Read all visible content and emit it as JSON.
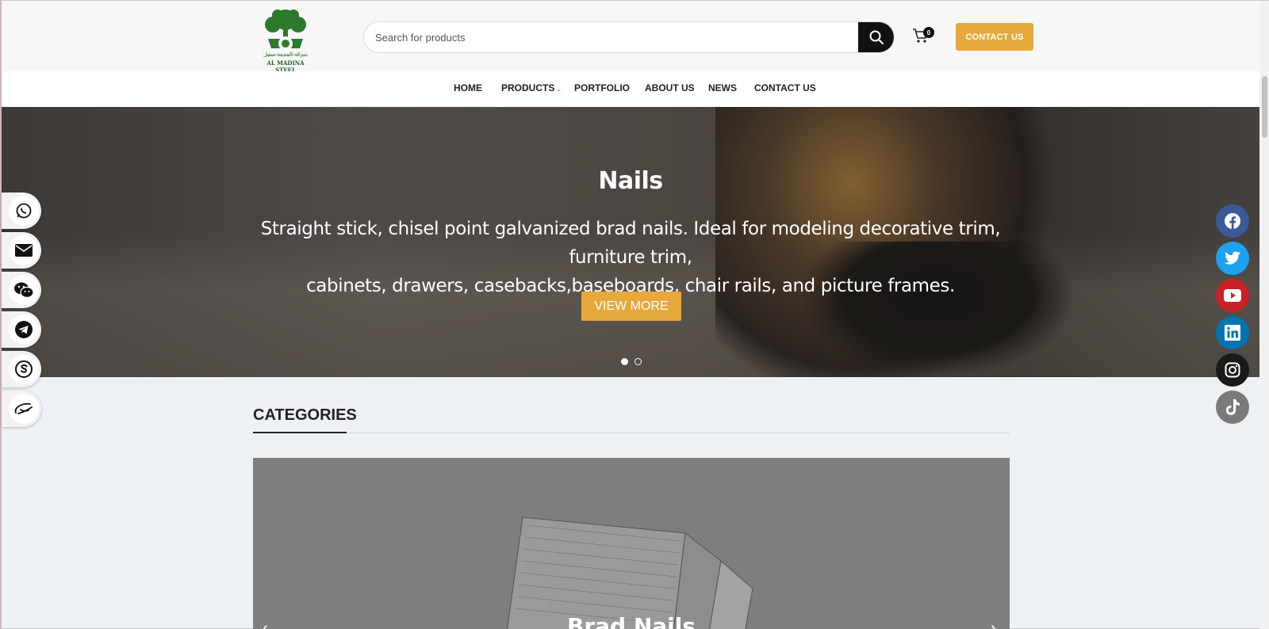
{
  "brand": {
    "logo_arabic": "شركة المدينة ستيل",
    "logo_english": "AL MADINA STEEL"
  },
  "header": {
    "search_placeholder": "Search for products",
    "cart_count": "0",
    "contact_label": "CONTACT US"
  },
  "nav": {
    "items": [
      "HOME",
      "PRODUCTS",
      "PORTFOLIO",
      "ABOUT US",
      "NEWS",
      "CONTACT US"
    ]
  },
  "hero": {
    "title": "Nails",
    "text_line1": "Straight stick, chisel point galvanized brad nails. Ideal for modeling decorative trim, furniture trim,",
    "text_line2": "cabinets, drawers, casebacks,baseboards, chair rails, and picture frames.",
    "button_label": "VIEW MORE",
    "slide_count": 2,
    "active_slide": 1
  },
  "categories": {
    "heading": "CATEGORIES",
    "card_label": "Brad Nails",
    "prev_icon": "‹",
    "next_icon": "›"
  },
  "left_contacts": [
    "whatsapp-icon",
    "mail-icon",
    "wechat-icon",
    "telegram-icon",
    "skype-icon",
    "alibaba-icon"
  ],
  "right_socials": [
    {
      "name": "facebook-icon",
      "color": "#3b5998"
    },
    {
      "name": "twitter-icon",
      "color": "#1da1f2"
    },
    {
      "name": "youtube-icon",
      "color": "#cb2027"
    },
    {
      "name": "linkedin-icon",
      "color": "#0274b3"
    },
    {
      "name": "instagram-icon",
      "color": "#1a1a1a"
    },
    {
      "name": "tiktok-icon",
      "color": "#7a7a7a"
    }
  ],
  "colors": {
    "accent": "#e6a93c",
    "logo_green": "#2d7a2d"
  }
}
